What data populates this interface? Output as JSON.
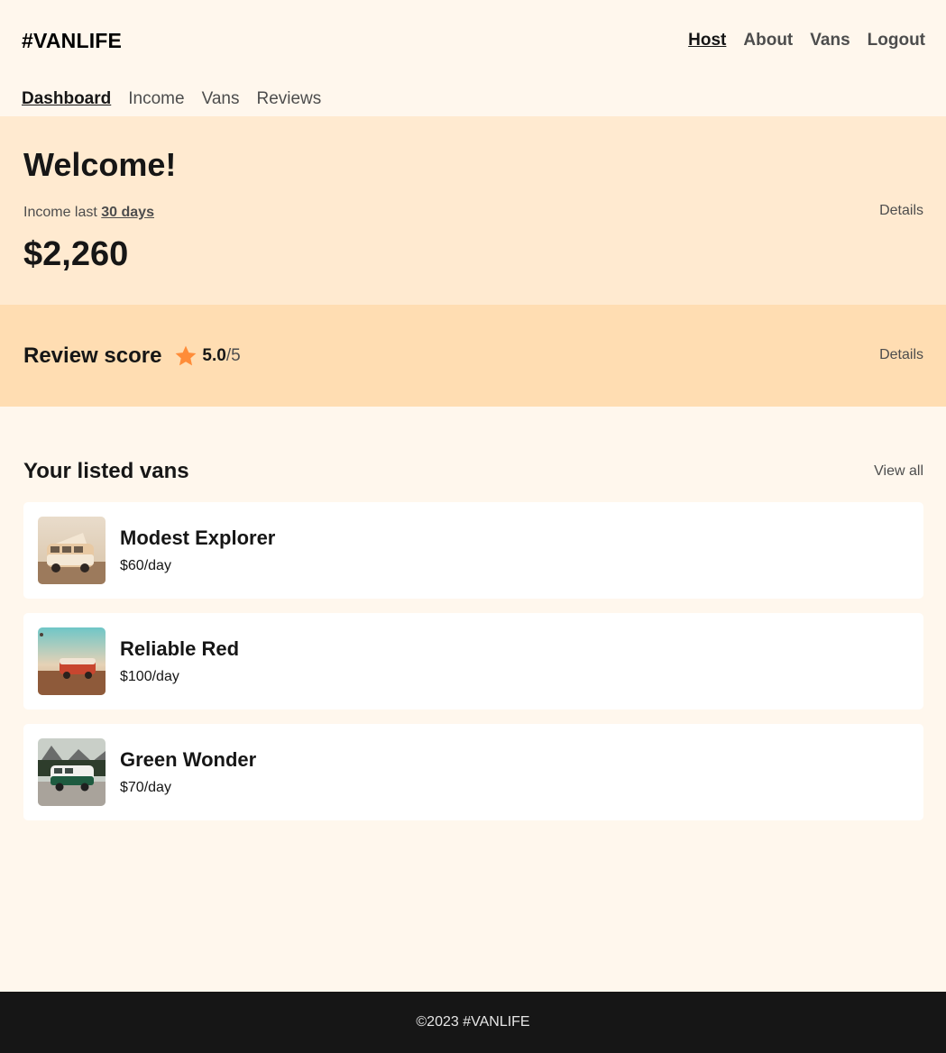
{
  "header": {
    "logo": "#VANLIFE",
    "nav": [
      {
        "label": "Host",
        "active": true
      },
      {
        "label": "About",
        "active": false
      },
      {
        "label": "Vans",
        "active": false
      },
      {
        "label": "Logout",
        "active": false
      }
    ]
  },
  "host_nav": [
    {
      "label": "Dashboard",
      "active": true
    },
    {
      "label": "Income",
      "active": false
    },
    {
      "label": "Vans",
      "active": false
    },
    {
      "label": "Reviews",
      "active": false
    }
  ],
  "welcome": {
    "title": "Welcome!",
    "income_prefix": "Income last ",
    "income_period": "30 days",
    "amount": "$2,260",
    "details_label": "Details"
  },
  "review": {
    "title": "Review score",
    "star_icon": "star-icon",
    "star_color": "#FF8C38",
    "score": "5.0",
    "out_of": "/5",
    "details_label": "Details"
  },
  "listed_vans": {
    "title": "Your listed vans",
    "view_all_label": "View all",
    "vans": [
      {
        "name": "Modest Explorer",
        "price": "$60/day"
      },
      {
        "name": "Reliable Red",
        "price": "$100/day"
      },
      {
        "name": "Green Wonder",
        "price": "$70/day"
      }
    ]
  },
  "footer": {
    "text": "©2023 #VANLIFE"
  },
  "colors": {
    "background": "#FFF7ED",
    "welcome_bg": "#FFEAD0",
    "review_bg": "#FFDDB2",
    "footer_bg": "#161616",
    "accent": "#FF8C38"
  }
}
